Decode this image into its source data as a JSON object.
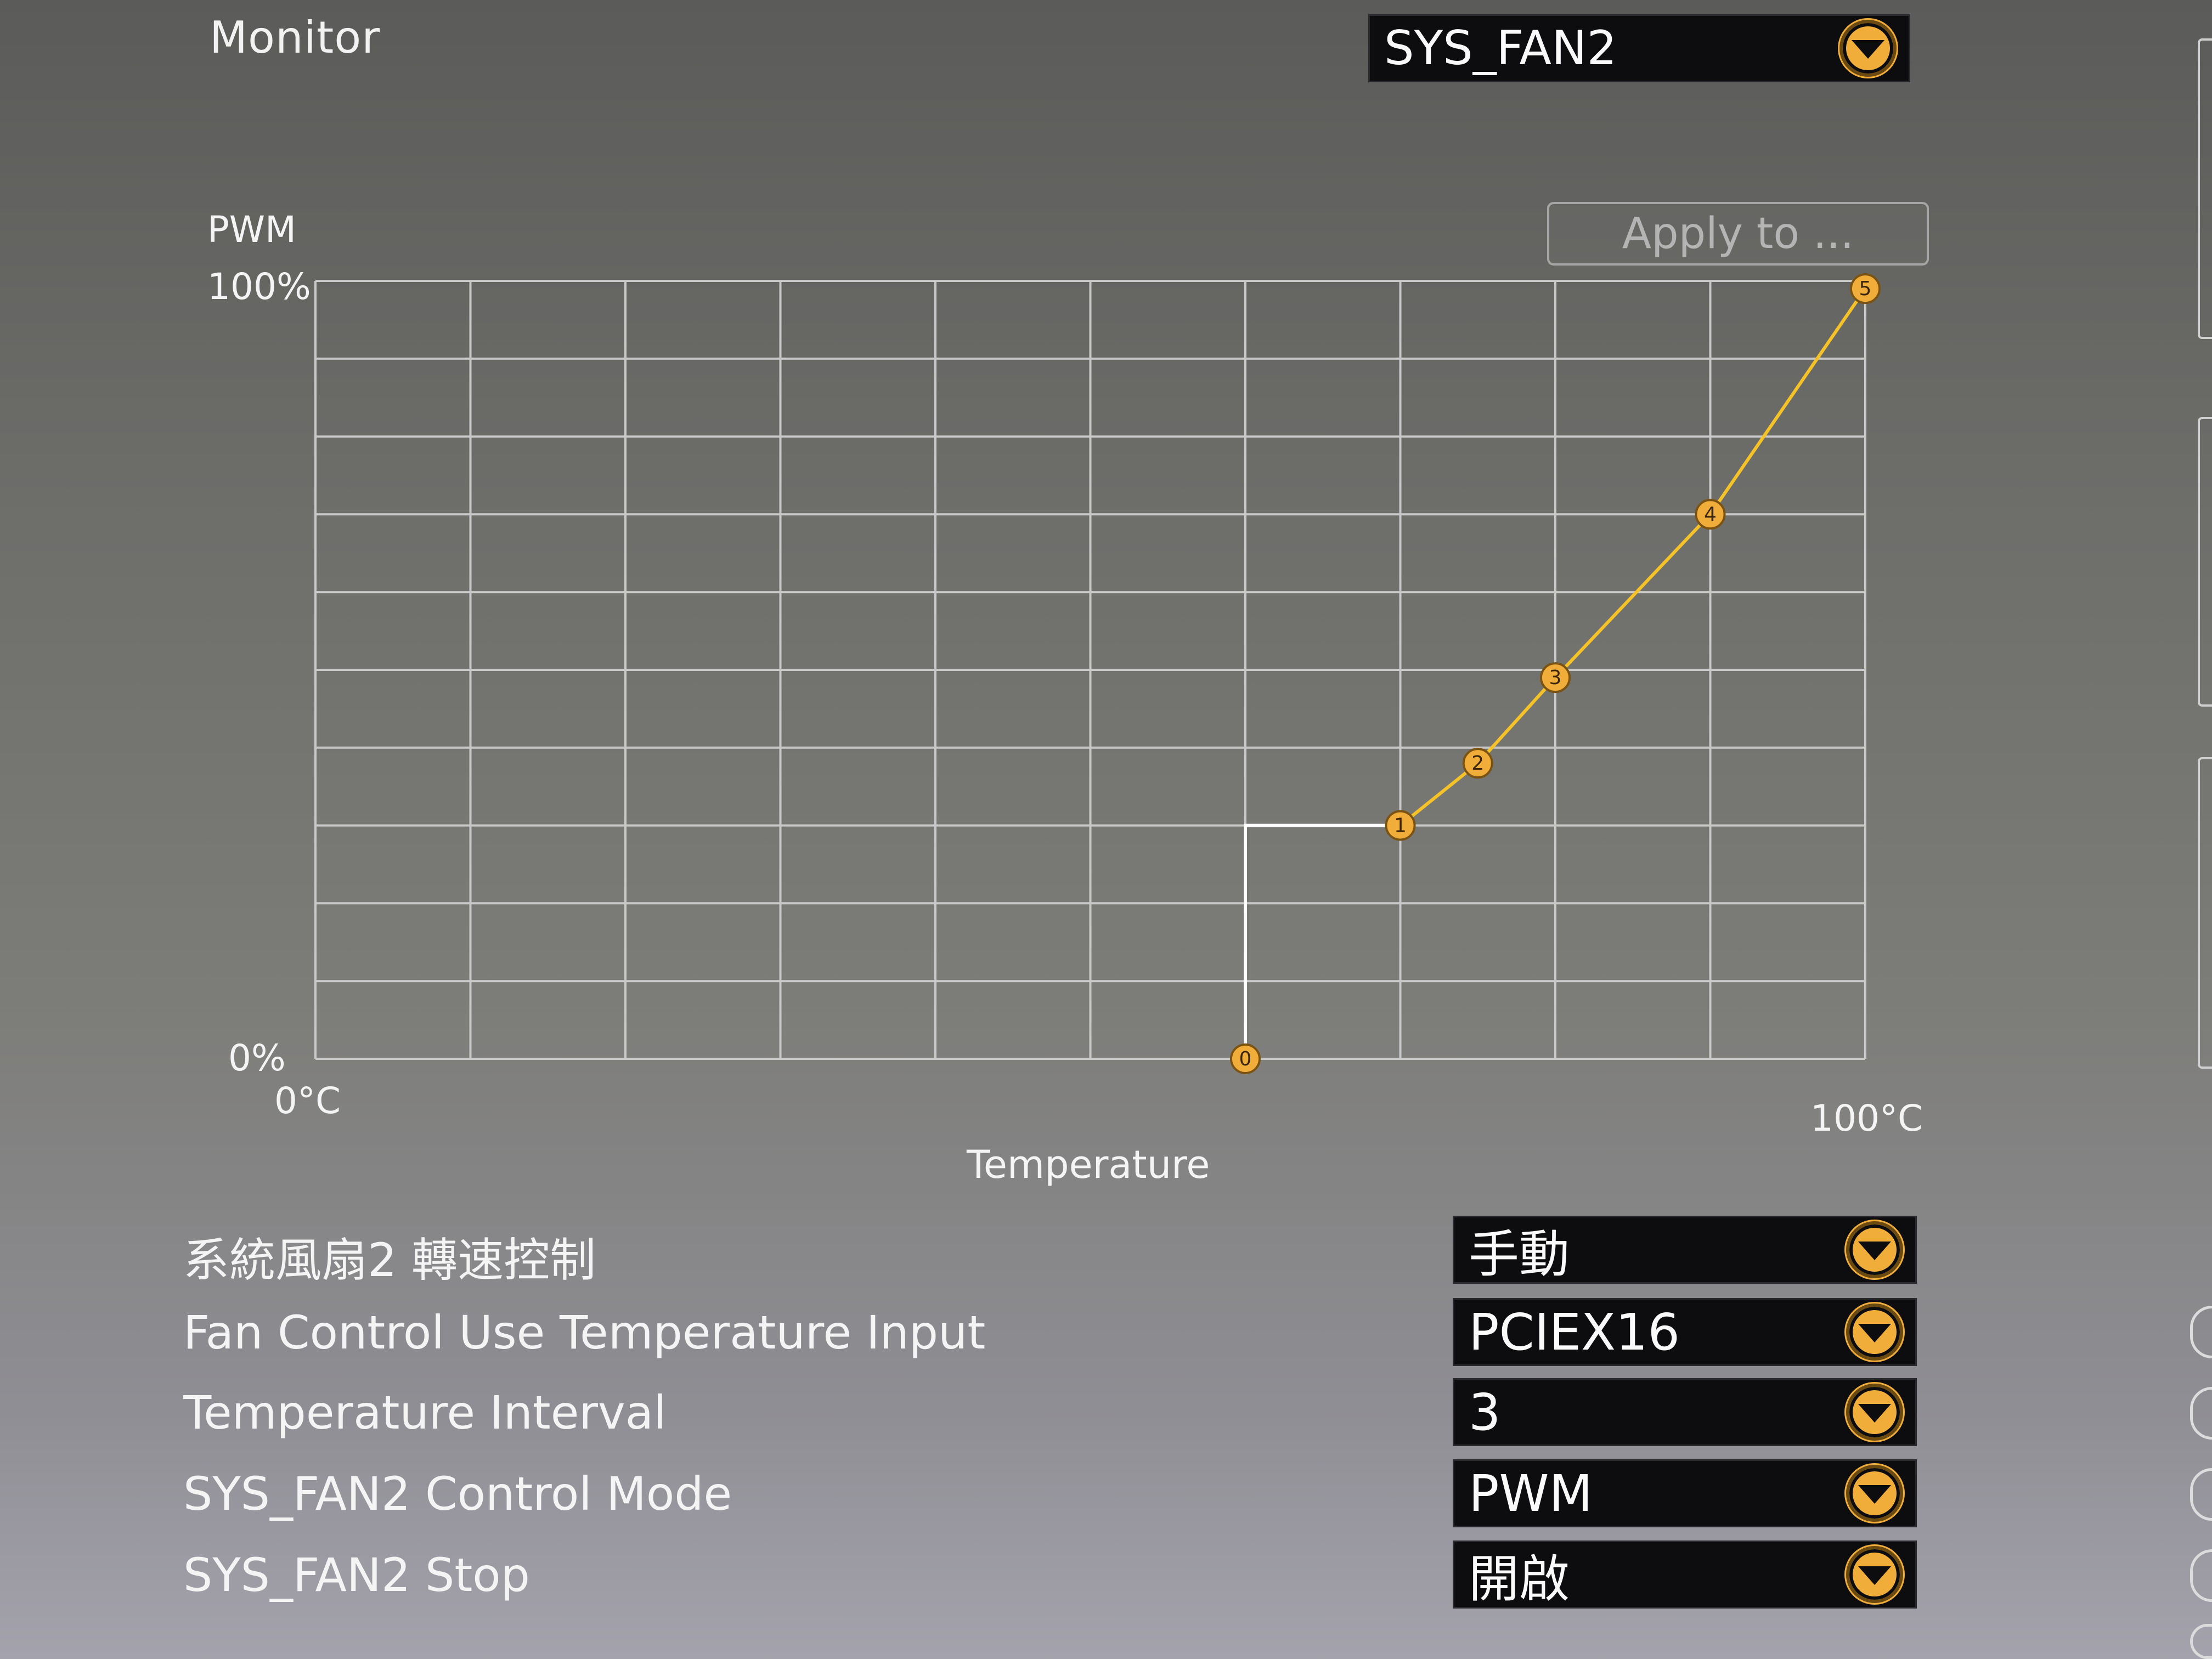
{
  "header": {
    "title": "Monitor"
  },
  "fan_selector": {
    "value": "SYS_FAN2"
  },
  "apply_button": {
    "label": "Apply to ..."
  },
  "chart_data": {
    "type": "line",
    "ylabel": "PWM",
    "y_top_label": "100%",
    "y_bottom_label": "0%",
    "x_left_label": "0°C",
    "x_right_label": "100°C",
    "xlabel": "Temperature",
    "xlim": [
      0,
      100
    ],
    "ylim": [
      0,
      100
    ],
    "grid": true,
    "points": [
      {
        "id": "0",
        "x": 60,
        "y": 0
      },
      {
        "id": "1",
        "x": 70,
        "y": 30
      },
      {
        "id": "2",
        "x": 75,
        "y": 38
      },
      {
        "id": "3",
        "x": 80,
        "y": 49
      },
      {
        "id": "4",
        "x": 90,
        "y": 70
      },
      {
        "id": "5",
        "x": 100,
        "y": 99
      }
    ],
    "step_line": {
      "x": 60,
      "y": 30
    },
    "curve_color": "#f5c228",
    "point_color": "#f0ad3a",
    "step_color": "#ffffff"
  },
  "settings": [
    {
      "label": "系統風扇2 轉速控制",
      "value": "手動"
    },
    {
      "label": "Fan Control Use Temperature Input",
      "value": "PCIEX16"
    },
    {
      "label": "Temperature Interval",
      "value": "3"
    },
    {
      "label": "SYS_FAN2 Control Mode",
      "value": "PWM"
    },
    {
      "label": "SYS_FAN2 Stop",
      "value": "開啟"
    }
  ]
}
